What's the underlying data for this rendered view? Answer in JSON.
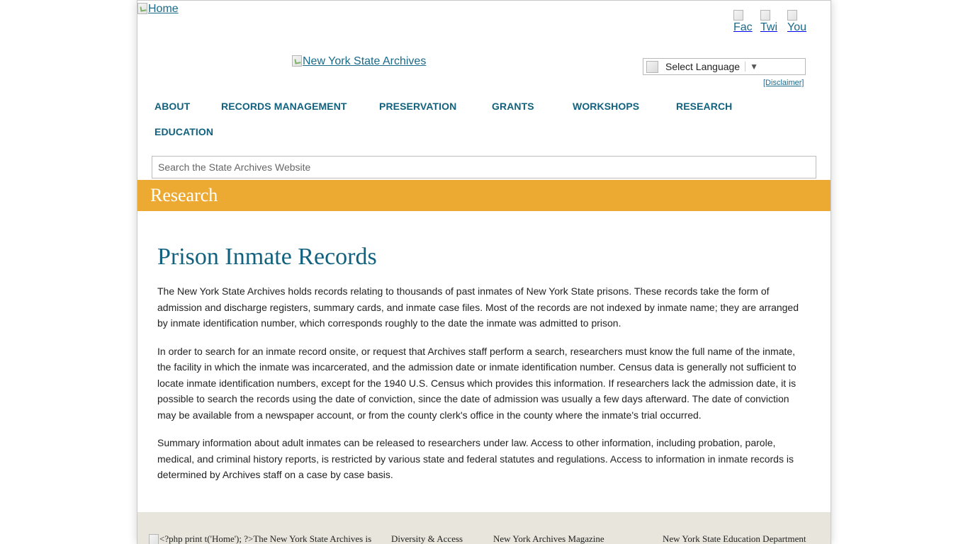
{
  "header": {
    "home_alt": "Home",
    "logo_alt": "New York State Archives",
    "social": [
      {
        "name": "facebook",
        "alt_visible": "Fac"
      },
      {
        "name": "twitter",
        "alt_visible": "Twi"
      },
      {
        "name": "youtube",
        "alt_visible": "You"
      }
    ],
    "language_select": {
      "label": "Select Language"
    },
    "disclaimer": "[Disclaimer]"
  },
  "nav": {
    "items": [
      {
        "label": "ABOUT"
      },
      {
        "label": "RECORDS MANAGEMENT"
      },
      {
        "label": "PRESERVATION"
      },
      {
        "label": "GRANTS"
      },
      {
        "label": "WORKSHOPS"
      },
      {
        "label": "RESEARCH"
      },
      {
        "label": "EDUCATION"
      }
    ]
  },
  "search": {
    "placeholder": "Search the State Archives Website"
  },
  "section": {
    "title": "Research"
  },
  "article": {
    "title": "Prison Inmate Records",
    "paragraphs": [
      "The New York State Archives holds records relating to thousands of past inmates of New York State prisons. These records take the form of admission and discharge registers, summary cards, and inmate case files.  Most of the records are not indexed by inmate name; they are arranged by inmate identification number, which corresponds roughly to the date the inmate was admitted to prison.",
      "In order to search for an inmate record onsite, or request that Archives staff perform a search, researchers must know the full name of the inmate, the facility in which the inmate was incarcerated, and the admission date or inmate identification number. Census data is generally not sufficient to locate inmate identification numbers, except for the 1940 U.S. Census which provides this information. If researchers lack the admission date, it is possible to search the records using the date of conviction, since the date of admission was usually a few days afterward. The date of conviction may be available from a newspaper account, or from the county clerk's office in the county where the inmate's trial occurred.",
      "Summary information about adult inmates can be released to researchers under law.  Access to other information, including probation, parole, medical, and criminal history reports, is restricted by various state and federal statutes and regulations.  Access to information in inmate records is determined by Archives staff on a case by case basis."
    ]
  },
  "footer": {
    "intro": "<?php print t('Home'); ?>The New York State Archives is",
    "links": [
      {
        "label": "Diversity & Access"
      },
      {
        "label": "New York Archives Magazine"
      },
      {
        "label": "New York State Education Department"
      }
    ]
  },
  "colors": {
    "accent_blue": "#12627f",
    "band_orange": "#edaa33",
    "footer_bg": "#e8e6dc"
  }
}
